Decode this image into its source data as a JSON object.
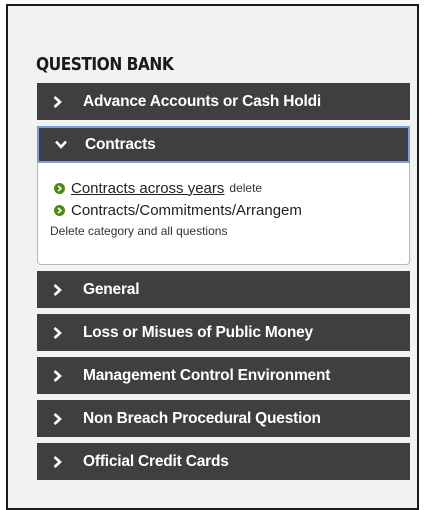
{
  "section_title": "QUESTION BANK",
  "categories": [
    {
      "label": "Advance Accounts or Cash Holdi",
      "expanded": false
    },
    {
      "label": "Contracts",
      "expanded": true
    },
    {
      "label": "General",
      "expanded": false
    },
    {
      "label": "Loss or Misues of Public Money",
      "expanded": false
    },
    {
      "label": "Management Control Environment",
      "expanded": false
    },
    {
      "label": "Non Breach Procedural Question",
      "expanded": false
    },
    {
      "label": "Official Credit Cards",
      "expanded": false
    }
  ],
  "contracts_panel": {
    "questions": [
      {
        "label": "Contracts across years",
        "action": "delete"
      },
      {
        "label": "Contracts/Commitments/Arrangem"
      }
    ],
    "delete_category": "Delete category and all questions"
  },
  "colors": {
    "header_bg": "#3f3f3f",
    "header_text": "#ffffff",
    "open_border": "#7aa0d8",
    "bullet": "#4a8a16",
    "page_bg": "#f2f2f2"
  },
  "icons": {
    "collapsed": "chevron-right-icon",
    "expanded": "chevron-down-icon",
    "bullet": "circle-arrow-icon"
  }
}
